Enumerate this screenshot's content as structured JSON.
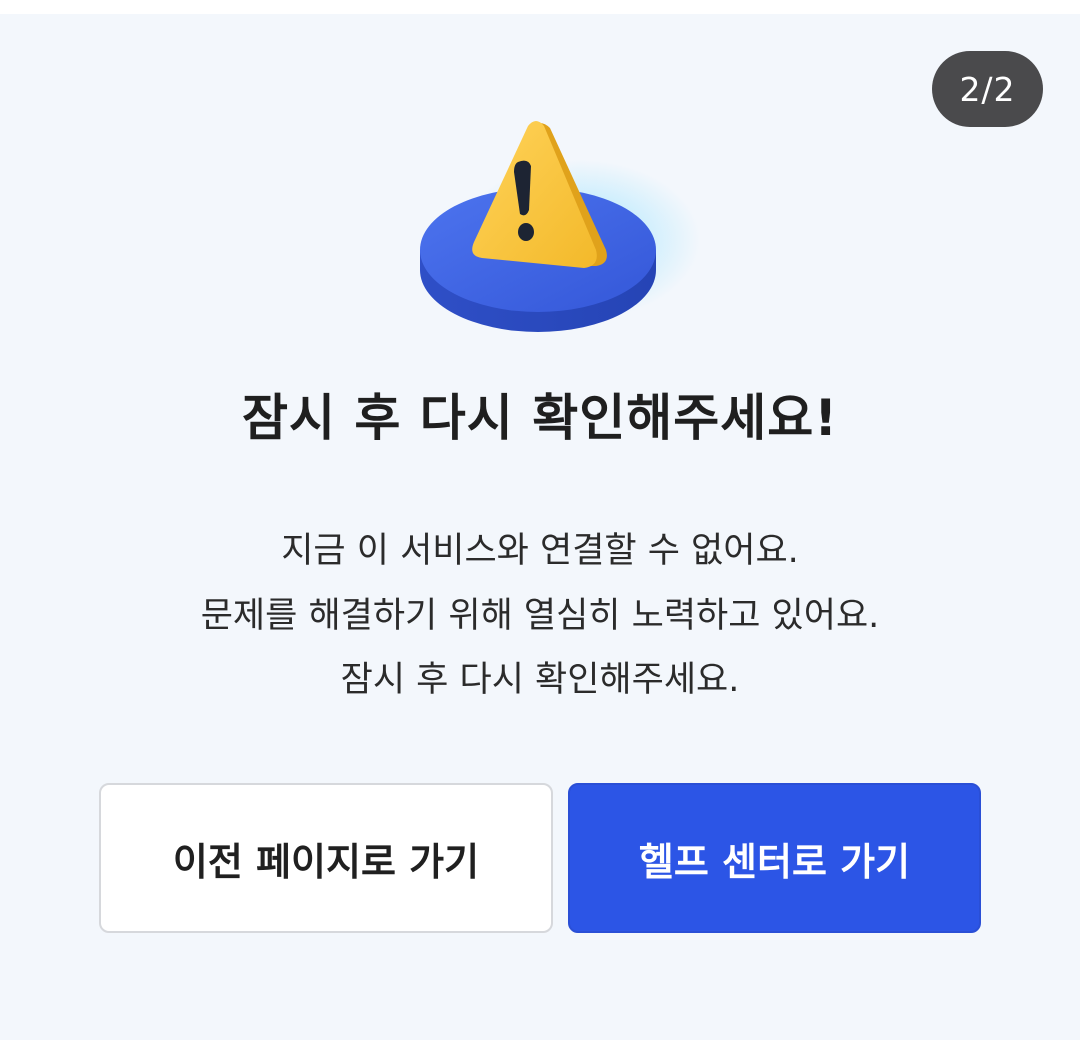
{
  "page_counter": "2/2",
  "heading": "잠시 후 다시 확인해주세요!",
  "description": [
    "지금 이 서비스와 연결할 수 없어요.",
    "문제를 해결하기 위해 열심히 노력하고 있어요.",
    "잠시 후 다시 확인해주세요."
  ],
  "buttons": {
    "previous_label": "이전 페이지로 가기",
    "help_label": "헬프 센터로 가기"
  },
  "illustration": {
    "icon": "warning-icon"
  },
  "colors": {
    "background": "#f3f7fc",
    "primary": "#2c55e6",
    "warning": "#f7c233",
    "counter_badge": "#4a4a4c"
  }
}
